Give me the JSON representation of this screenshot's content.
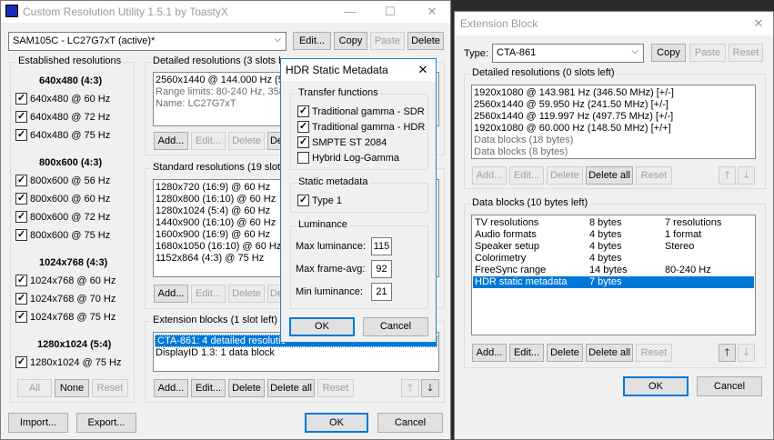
{
  "cru": {
    "title": "Custom Resolution Utility 1.5.1 by ToastyX",
    "monitor": "SAM105C - LC27G7xT (active)*",
    "buttons": {
      "edit": "Edit...",
      "copy": "Copy",
      "paste": "Paste",
      "delete": "Delete"
    },
    "established": {
      "label": "Established resolutions",
      "groups": [
        {
          "header": "640x480 (4:3)",
          "items": [
            "640x480 @ 60 Hz",
            "640x480 @ 72 Hz",
            "640x480 @ 75 Hz"
          ]
        },
        {
          "header": "800x600 (4:3)",
          "items": [
            "800x600 @ 56 Hz",
            "800x600 @ 60 Hz",
            "800x600 @ 72 Hz",
            "800x600 @ 75 Hz"
          ]
        },
        {
          "header": "1024x768 (4:3)",
          "items": [
            "1024x768 @ 60 Hz",
            "1024x768 @ 70 Hz",
            "1024x768 @ 75 Hz"
          ]
        },
        {
          "header": "1280x1024 (5:4)",
          "items": [
            "1280x1024 @ 75 Hz"
          ]
        }
      ],
      "all": "All",
      "none": "None",
      "reset": "Reset"
    },
    "detailed": {
      "label": "Detailed resolutions (3 slots le",
      "items": [
        "2560x1440 @ 144.000 Hz (5",
        "Range limits: 80-240 Hz, 358",
        "Name: LC27G7xT"
      ],
      "add": "Add...",
      "edit": "Edit...",
      "delete": "Delete",
      "partial": "De"
    },
    "standard": {
      "label": "Standard resolutions (19 slots",
      "items": [
        "1280x720 (16:9) @ 60 Hz",
        "1280x800 (16:10) @ 60 Hz",
        "1280x1024 (5:4) @ 60 Hz",
        "1440x900 (16:10) @ 60 Hz",
        "1600x900 (16:9) @ 60 Hz",
        "1680x1050 (16:10) @ 60 Hz",
        "1152x864 (4:3) @ 75 Hz"
      ],
      "add": "Add...",
      "edit": "Edit...",
      "delete": "Delete",
      "partial": "De"
    },
    "extension": {
      "label": "Extension blocks (1 slot left)",
      "items": [
        "CTA-861: 4 detailed resolutio",
        "DisplayID 1.3: 1 data block"
      ],
      "add": "Add...",
      "edit": "Edit...",
      "delete": "Delete",
      "delete_all": "Delete all",
      "reset": "Reset"
    },
    "import": "Import...",
    "export": "Export...",
    "ok": "OK",
    "cancel": "Cancel"
  },
  "hdr": {
    "title": "HDR Static Metadata",
    "transfer": {
      "label": "Transfer functions",
      "items": [
        {
          "label": "Traditional gamma - SDR",
          "checked": true
        },
        {
          "label": "Traditional gamma - HDR",
          "checked": true
        },
        {
          "label": "SMPTE ST 2084",
          "checked": true
        },
        {
          "label": "Hybrid Log-Gamma",
          "checked": false
        }
      ]
    },
    "static": {
      "label": "Static metadata",
      "type1": "Type 1"
    },
    "luminance": {
      "label": "Luminance",
      "max_label": "Max luminance:",
      "max": "115",
      "avg_label": "Max frame-avg:",
      "avg": "92",
      "min_label": "Min luminance:",
      "min": "21"
    },
    "ok": "OK",
    "cancel": "Cancel"
  },
  "ext": {
    "title": "Extension Block",
    "type_label": "Type:",
    "type": "CTA-861",
    "copy": "Copy",
    "paste": "Paste",
    "reset": "Reset",
    "detailed": {
      "label": "Detailed resolutions (0 slots left)",
      "items": [
        "1920x1080 @ 143.981 Hz (346.50 MHz) [+/-]",
        "2560x1440 @ 59.950 Hz (241.50 MHz) [+/-]",
        "2560x1440 @ 119.997 Hz (497.75 MHz) [+/-]",
        "1920x1080 @ 60.000 Hz (148.50 MHz) [+/+]"
      ],
      "gray_items": [
        "Data blocks (18 bytes)",
        "Data blocks (8 bytes)"
      ],
      "add": "Add...",
      "edit": "Edit...",
      "delete": "Delete",
      "delete_all": "Delete all",
      "reset": "Reset"
    },
    "datablocks": {
      "label": "Data blocks (10 bytes left)",
      "rows": [
        {
          "name": "TV resolutions",
          "size": "8 bytes",
          "info": "7 resolutions"
        },
        {
          "name": "Audio formats",
          "size": "4 bytes",
          "info": "1 format"
        },
        {
          "name": "Speaker setup",
          "size": "4 bytes",
          "info": "Stereo"
        },
        {
          "name": "Colorimetry",
          "size": "4 bytes",
          "info": ""
        },
        {
          "name": "FreeSync range",
          "size": "14 bytes",
          "info": "80-240 Hz"
        },
        {
          "name": "HDR static metadata",
          "size": "7 bytes",
          "info": ""
        }
      ],
      "add": "Add...",
      "edit": "Edit...",
      "delete": "Delete",
      "delete_all": "Delete all",
      "reset": "Reset"
    },
    "ok": "OK",
    "cancel": "Cancel"
  }
}
